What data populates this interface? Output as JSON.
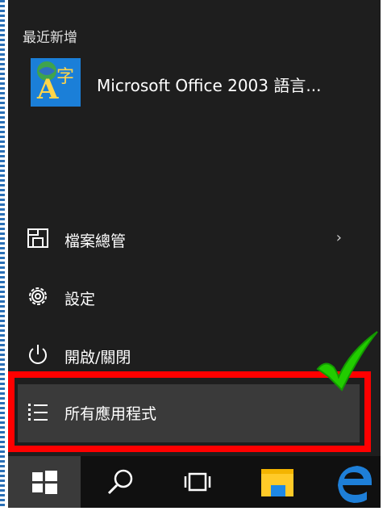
{
  "start_menu": {
    "recent": {
      "header": "最近新增",
      "items": [
        {
          "name": "Microsoft Office 2003 語言...",
          "icon": "office-language-icon"
        }
      ]
    },
    "items": [
      {
        "label": "檔案總管",
        "icon": "file-explorer-icon",
        "has_submenu": true,
        "chevron": "›"
      },
      {
        "label": "設定",
        "icon": "gear-icon"
      },
      {
        "label": "開啟/關閉",
        "icon": "power-icon"
      },
      {
        "label": "所有應用程式",
        "icon": "all-apps-list-icon"
      }
    ]
  },
  "taskbar": {
    "buttons": [
      {
        "icon": "windows-start-icon"
      },
      {
        "icon": "search-icon"
      },
      {
        "icon": "task-view-icon"
      },
      {
        "icon": "folder-icon"
      },
      {
        "icon": "edge-icon"
      }
    ]
  },
  "annotation": {
    "highlight_color": "#ff0000",
    "check_color": "#22cc00"
  },
  "colors": {
    "menu_bg": "#1e1e1e",
    "taskbar_bg": "#101010",
    "tile_blue": "#1b7fd8",
    "edge_blue": "#1e7fd8"
  }
}
